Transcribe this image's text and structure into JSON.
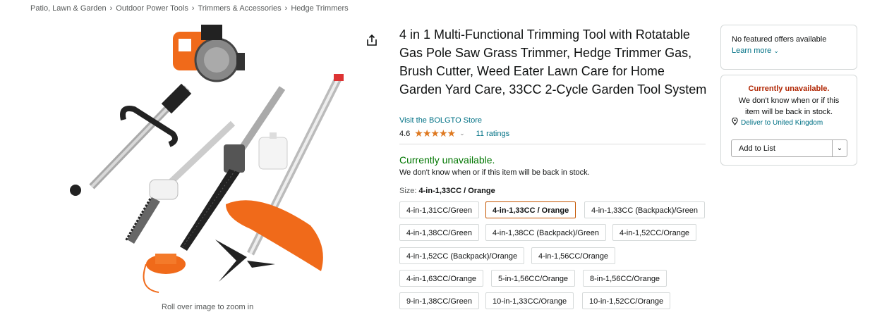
{
  "breadcrumb": [
    "Patio, Lawn & Garden",
    "Outdoor Power Tools",
    "Trimmers & Accessories",
    "Hedge Trimmers"
  ],
  "breadcrumb_separator": "›",
  "product": {
    "title": "4 in 1 Multi-Functional Trimming Tool with Rotatable Gas Pole Saw Grass Trimmer, Hedge Trimmer Gas, Brush Cutter, Weed Eater Lawn Care for Home Garden Yard Care, 33CC 2-Cycle Garden Tool System",
    "store_link": "Visit the BOLGTO Store",
    "rating": "4.6",
    "rating_value": 4.6,
    "stars": "★★★★★",
    "rating_chevron": "⌄",
    "ratings_count": "11 ratings",
    "image_zoom_hint": "Roll over image to zoom in"
  },
  "availability": {
    "status": "Currently unavailable.",
    "detail": "We don't know when or if this item will be back in stock."
  },
  "size": {
    "label": "Size:",
    "selected": "4-in-1,33CC / Orange",
    "options": [
      "4-in-1,31CC/Green",
      "4-in-1,33CC / Orange",
      "4-in-1,33CC (Backpack)/Green",
      "4-in-1,38CC/Green",
      "4-in-1,38CC (Backpack)/Green",
      "4-in-1,52CC/Orange",
      "4-in-1,52CC (Backpack)/Orange",
      "4-in-1,56CC/Orange",
      "4-in-1,63CC/Orange",
      "5-in-1,56CC/Orange",
      "8-in-1,56CC/Orange",
      "9-in-1,38CC/Green",
      "10-in-1,33CC/Orange",
      "10-in-1,52CC/Orange"
    ]
  },
  "buybox": {
    "no_offers": "No featured offers available",
    "learn_more": "Learn more",
    "learn_more_chevron": "⌄",
    "status": "Currently unavailable.",
    "detail": "We don't know when or if this item will be back in stock.",
    "deliver": "Deliver to United Kingdom",
    "add_to_list": "Add to List",
    "add_to_list_caret": "⌄"
  },
  "colors": {
    "link": "#007185",
    "available_green": "#007600",
    "unavailable_red": "#b12704",
    "star": "#de7921",
    "selected_border": "#c45500"
  }
}
